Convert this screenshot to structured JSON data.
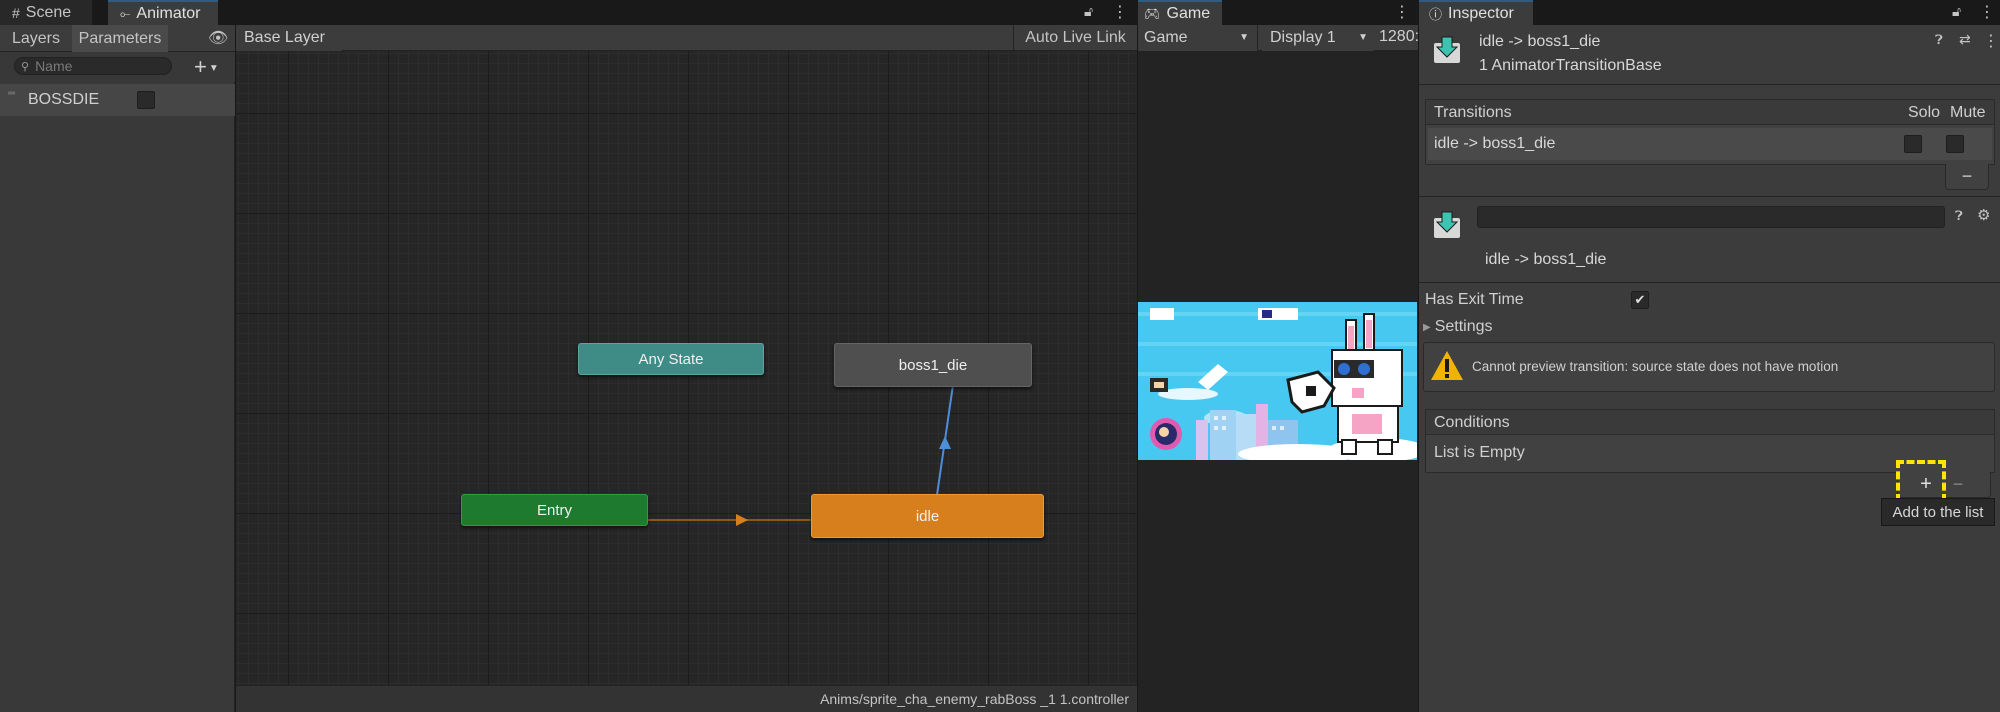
{
  "tabs": {
    "scene": "Scene",
    "animator": "Animator",
    "game": "Game",
    "inspector": "Inspector"
  },
  "animator": {
    "subtabs": {
      "layers": "Layers",
      "parameters": "Parameters"
    },
    "search_placeholder": "Name",
    "parameters": [
      {
        "name": "BOSSDIE",
        "type": "bool",
        "value": false
      }
    ],
    "breadcrumb": "Base Layer",
    "auto_live_link": "Auto Live Link",
    "nodes": {
      "any_state": "Any State",
      "entry": "Entry",
      "idle": "idle",
      "boss1_die": "boss1_die"
    },
    "status_path": "Anims/sprite_cha_enemy_rabBoss _1 1.controller"
  },
  "game": {
    "view_dropdown": "Game",
    "display_dropdown": "Display 1",
    "resolution": "1280:"
  },
  "inspector": {
    "header_title": "idle -> boss1_die",
    "header_subtitle": "1 AnimatorTransitionBase",
    "transitions_label": "Transitions",
    "solo_label": "Solo",
    "mute_label": "Mute",
    "transition_row": "idle -> boss1_die",
    "transition_name_value": "",
    "transition_caption": "idle -> boss1_die",
    "has_exit_time_label": "Has Exit Time",
    "has_exit_time_value": true,
    "settings_label": "Settings",
    "warning_text": "Cannot preview transition: source state does not have motion",
    "conditions_label": "Conditions",
    "conditions_empty": "List is Empty",
    "add_tooltip": "Add to the list",
    "minus_symbol": "−",
    "plus_symbol": "+"
  },
  "colors": {
    "any_state": "#3f8c86",
    "entry": "#1e7a2f",
    "idle": "#d67f1c",
    "boss1_die": "#4f4f4f",
    "highlight": "#ffe500",
    "active_tab": "#2c5d87"
  }
}
